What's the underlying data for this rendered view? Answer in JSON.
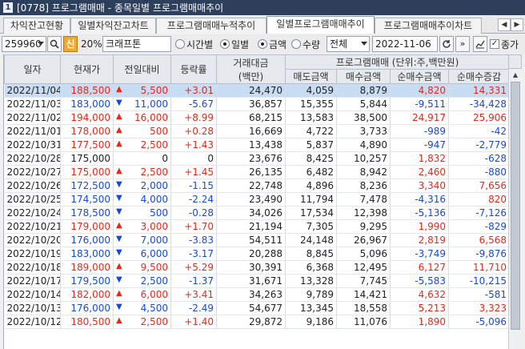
{
  "window": {
    "number": "1",
    "title": "[0778] 프로그램매매 - 종목일별 프로그램매매추이"
  },
  "tabs": [
    {
      "label": "차익잔고현황",
      "active": false
    },
    {
      "label": "일별차익잔고차트",
      "active": false
    },
    {
      "label": "프로그램매매누적추이",
      "active": false
    },
    {
      "label": "일별프로그램매매추이",
      "active": true
    },
    {
      "label": "프로그램매매추이차트",
      "active": false
    }
  ],
  "toolbar": {
    "code": "259960",
    "sin_label": "신",
    "margin": "20%",
    "stock_name": "크래프톤",
    "radio_time": "시간별",
    "radio_daily": "일별",
    "radio_amount": "금액",
    "radio_qty": "수량",
    "filter": "전체",
    "date": "2022-11-06",
    "checkbox_close": "종가"
  },
  "table": {
    "headers": {
      "date": "일자",
      "price": "현재가",
      "change": "전일대비",
      "rate": "등락률",
      "volume": "거래대금",
      "volume_unit": "(백만)",
      "program_group": "프로그램매매 (단위:주,백만원)",
      "sell": "매도금액",
      "buy": "매수금액",
      "net": "순매수금액",
      "net_inc": "순매수증감"
    },
    "rows": [
      {
        "date": "2022/11/04",
        "price": "188,500",
        "dir": "up",
        "change": "5,500",
        "rate": "+3.01",
        "volume": "24,470",
        "sell": "4,059",
        "buy": "8,879",
        "net": "4,820",
        "net_inc": "14,331"
      },
      {
        "date": "2022/11/03",
        "price": "183,000",
        "dir": "down",
        "change": "11,000",
        "rate": "-5.67",
        "volume": "36,857",
        "sell": "15,355",
        "buy": "5,844",
        "net": "-9,511",
        "net_inc": "-34,428"
      },
      {
        "date": "2022/11/02",
        "price": "194,000",
        "dir": "up",
        "change": "16,000",
        "rate": "+8.99",
        "volume": "68,215",
        "sell": "13,583",
        "buy": "38,500",
        "net": "24,917",
        "net_inc": "25,906"
      },
      {
        "date": "2022/11/01",
        "price": "178,000",
        "dir": "up",
        "change": "500",
        "rate": "+0.28",
        "volume": "16,669",
        "sell": "4,722",
        "buy": "3,733",
        "net": "-989",
        "net_inc": "-42"
      },
      {
        "date": "2022/10/31",
        "price": "177,500",
        "dir": "up",
        "change": "2,500",
        "rate": "+1.43",
        "volume": "13,438",
        "sell": "5,837",
        "buy": "4,890",
        "net": "-947",
        "net_inc": "-2,779"
      },
      {
        "date": "2022/10/28",
        "price": "175,000",
        "dir": "flat",
        "change": "0",
        "rate": "0",
        "volume": "23,676",
        "sell": "8,425",
        "buy": "10,257",
        "net": "1,832",
        "net_inc": "-628"
      },
      {
        "date": "2022/10/27",
        "price": "175,000",
        "dir": "up",
        "change": "2,500",
        "rate": "+1.45",
        "volume": "26,135",
        "sell": "6,482",
        "buy": "8,942",
        "net": "2,460",
        "net_inc": "-880"
      },
      {
        "date": "2022/10/26",
        "price": "172,500",
        "dir": "down",
        "change": "2,000",
        "rate": "-1.15",
        "volume": "22,748",
        "sell": "4,896",
        "buy": "8,236",
        "net": "3,340",
        "net_inc": "7,656"
      },
      {
        "date": "2022/10/25",
        "price": "174,500",
        "dir": "down",
        "change": "4,000",
        "rate": "-2.24",
        "volume": "23,490",
        "sell": "11,794",
        "buy": "7,478",
        "net": "-4,316",
        "net_inc": "820"
      },
      {
        "date": "2022/10/24",
        "price": "178,500",
        "dir": "down",
        "change": "500",
        "rate": "-0.28",
        "volume": "34,026",
        "sell": "17,534",
        "buy": "12,398",
        "net": "-5,136",
        "net_inc": "-7,126"
      },
      {
        "date": "2022/10/21",
        "price": "179,000",
        "dir": "up",
        "change": "3,000",
        "rate": "+1.70",
        "volume": "21,194",
        "sell": "7,305",
        "buy": "9,295",
        "net": "1,990",
        "net_inc": "-829"
      },
      {
        "date": "2022/10/20",
        "price": "176,000",
        "dir": "down",
        "change": "7,000",
        "rate": "-3.83",
        "volume": "54,511",
        "sell": "24,148",
        "buy": "26,967",
        "net": "2,819",
        "net_inc": "6,568"
      },
      {
        "date": "2022/10/19",
        "price": "183,000",
        "dir": "down",
        "change": "6,000",
        "rate": "-3.17",
        "volume": "20,288",
        "sell": "8,845",
        "buy": "5,096",
        "net": "-3,749",
        "net_inc": "-9,876"
      },
      {
        "date": "2022/10/18",
        "price": "189,000",
        "dir": "up",
        "change": "9,500",
        "rate": "+5.29",
        "volume": "30,391",
        "sell": "6,368",
        "buy": "12,495",
        "net": "6,127",
        "net_inc": "11,710"
      },
      {
        "date": "2022/10/17",
        "price": "179,500",
        "dir": "down",
        "change": "2,500",
        "rate": "-1.37",
        "volume": "31,671",
        "sell": "13,328",
        "buy": "7,745",
        "net": "-5,583",
        "net_inc": "-10,215"
      },
      {
        "date": "2022/10/14",
        "price": "182,000",
        "dir": "up",
        "change": "6,000",
        "rate": "+3.41",
        "volume": "34,263",
        "sell": "9,789",
        "buy": "14,421",
        "net": "4,632",
        "net_inc": "-581"
      },
      {
        "date": "2022/10/13",
        "price": "176,000",
        "dir": "down",
        "change": "4,500",
        "rate": "-2.49",
        "volume": "54,677",
        "sell": "13,345",
        "buy": "18,558",
        "net": "5,213",
        "net_inc": "3,323"
      },
      {
        "date": "2022/10/12",
        "price": "180,500",
        "dir": "up",
        "change": "2,500",
        "rate": "+1.40",
        "volume": "29,872",
        "sell": "9,186",
        "buy": "11,076",
        "net": "1,890",
        "net_inc": "-5,096"
      }
    ]
  },
  "colors": {
    "up": "#e8271b",
    "down": "#1848d9",
    "selected_row": "#c8dcf3",
    "titlebar": "#2e3f5c"
  }
}
